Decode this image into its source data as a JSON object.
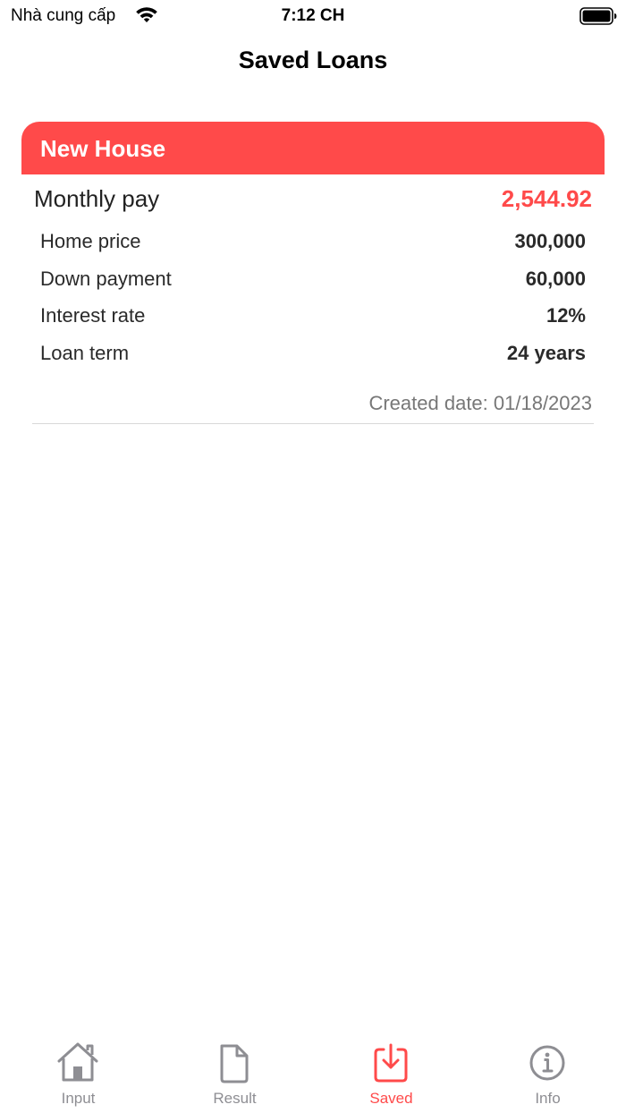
{
  "status_bar": {
    "carrier": "Nhà cung cấp",
    "time": "7:12 CH"
  },
  "nav": {
    "title": "Saved Loans"
  },
  "loan": {
    "name": "New House",
    "monthly_label": "Monthly pay",
    "monthly_value": "2,544.92",
    "details": [
      {
        "label": "Home price",
        "value": "300,000"
      },
      {
        "label": "Down payment",
        "value": "60,000"
      },
      {
        "label": "Interest rate",
        "value": "12%"
      },
      {
        "label": "Loan term",
        "value": "24 years"
      }
    ],
    "created": "Created date: 01/18/2023"
  },
  "tabs": [
    {
      "label": "Input",
      "icon": "house-icon",
      "active": false
    },
    {
      "label": "Result",
      "icon": "document-icon",
      "active": false
    },
    {
      "label": "Saved",
      "icon": "download-tray-icon",
      "active": true
    },
    {
      "label": "Info",
      "icon": "info-circle-icon",
      "active": false
    }
  ],
  "colors": {
    "accent": "#ff4a4a",
    "inactive": "#8e8e93"
  }
}
